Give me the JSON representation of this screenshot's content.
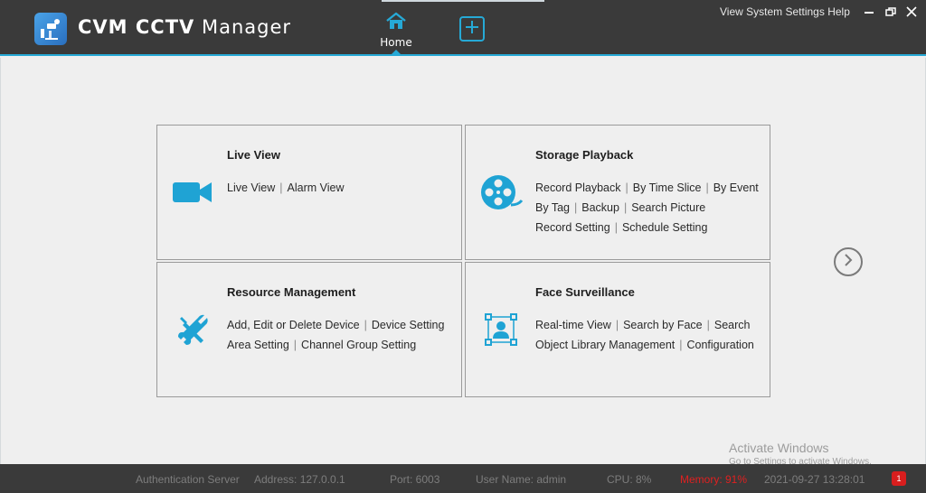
{
  "app": {
    "title_bold": "CVM CCTV",
    "title_light": "Manager"
  },
  "tabs": {
    "home_label": "Home"
  },
  "system_menu": {
    "view": "View",
    "system": "System",
    "settings": "Settings",
    "help": "Help"
  },
  "panels": {
    "live_view": {
      "title": "Live View",
      "rows": [
        [
          "Live View",
          "Alarm View"
        ]
      ]
    },
    "storage_playback": {
      "title": "Storage Playback",
      "rows": [
        [
          "Record Playback",
          "By Time Slice",
          "By Event"
        ],
        [
          "By Tag",
          "Backup",
          "Search Picture"
        ],
        [
          "Record Setting",
          "Schedule Setting"
        ]
      ]
    },
    "resource_management": {
      "title": "Resource Management",
      "rows": [
        [
          "Add, Edit or Delete Device",
          "Device Setting"
        ],
        [
          "Area Setting",
          "Channel Group Setting"
        ]
      ]
    },
    "face_surveillance": {
      "title": "Face Surveillance",
      "rows": [
        [
          "Real-time View",
          "Search by Face",
          "Search"
        ],
        [
          "Object Library Management",
          "Configuration"
        ]
      ]
    }
  },
  "separator": "|",
  "windows_notice": {
    "line1": "Activate Windows",
    "line2": "Go to Settings to activate Windows."
  },
  "status": {
    "auth_server": "Authentication Server",
    "address": "Address: 127.0.0.1",
    "port": "Port: 6003",
    "user": "User Name: admin",
    "cpu": "CPU: 8%",
    "memory": "Memory: 91%",
    "datetime": "2021-09-27 13:28:01",
    "alarm_count": "1"
  },
  "colors": {
    "accent": "#26a9d6",
    "titlebar": "#3a3a3a",
    "warning": "#e02020"
  }
}
